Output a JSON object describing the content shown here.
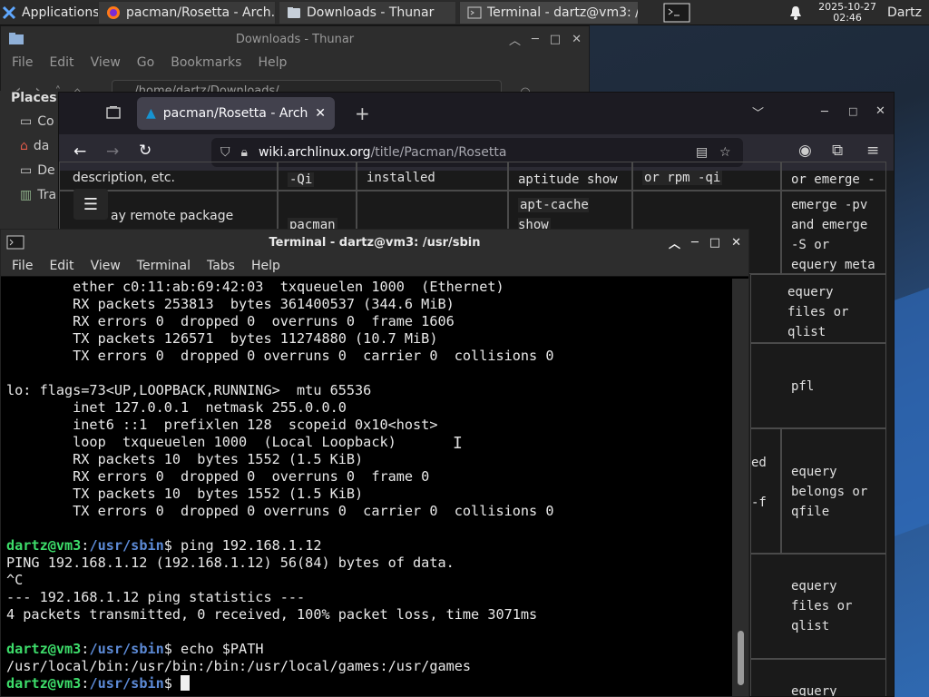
{
  "panel": {
    "apps_label": "Applications",
    "tasks": [
      {
        "label": "pacman/Rosetta - Arch...",
        "icon": "firefox-icon"
      },
      {
        "label": "Downloads - Thunar",
        "icon": "folder-icon"
      },
      {
        "label": "Terminal - dartz@vm3: /...",
        "icon": "terminal-icon"
      }
    ],
    "clock_date": "2025-10-27",
    "clock_time": "02:46",
    "user": "Dartz"
  },
  "thunar": {
    "title": "Downloads - Thunar",
    "menu": [
      "File",
      "Edit",
      "View",
      "Go",
      "Bookmarks",
      "Help"
    ],
    "path": "/home/dartz/Downloads/",
    "places_title": "Places",
    "places": [
      "Co",
      "da",
      "De",
      "Tra"
    ]
  },
  "firefox": {
    "tab_title": "pacman/Rosetta - ArchW",
    "url_host": "wiki.archlinux.org",
    "url_path": "/title/Pacman/Rosetta"
  },
  "wiki": {
    "row1_desc": "description, etc.",
    "row1_qi": "-Qi",
    "row1_installed": "installed",
    "row1_aptitude": "aptitude show",
    "row1_rpm": "or rpm -qi",
    "row1_emerge": "or emerge -S",
    "row2_desc": "ay remote package",
    "row2_pacman": "pacman",
    "row2_apt": "apt-cache show",
    "row2_emerge": "emerge -pv and emerge -S or equery meta",
    "row3": "equery files or qlist",
    "row4": "pfl",
    "row5_a": "ed",
    "row5_b": "-f",
    "row5": "equery belongs or qfile",
    "row6": "equery files or qlist",
    "row7": "equery"
  },
  "terminal": {
    "title": "Terminal - dartz@vm3: /usr/sbin",
    "menu": [
      "File",
      "Edit",
      "View",
      "Terminal",
      "Tabs",
      "Help"
    ],
    "prompt_user": "dartz@vm3",
    "prompt_path": "/usr/sbin",
    "lines": [
      "        ether c0:11:ab:69:42:03  txqueuelen 1000  (Ethernet)",
      "        RX packets 253813  bytes 361400537 (344.6 MiB)",
      "        RX errors 0  dropped 0  overruns 0  frame 1606",
      "        TX packets 126571  bytes 11274880 (10.7 MiB)",
      "        TX errors 0  dropped 0 overruns 0  carrier 0  collisions 0",
      "",
      "lo: flags=73<UP,LOOPBACK,RUNNING>  mtu 65536",
      "        inet 127.0.0.1  netmask 255.0.0.0",
      "        inet6 ::1  prefixlen 128  scopeid 0x10<host>",
      "        loop  txqueuelen 1000  (Local Loopback)",
      "        RX packets 10  bytes 1552 (1.5 KiB)",
      "        RX errors 0  dropped 0  overruns 0  frame 0",
      "        TX packets 10  bytes 1552 (1.5 KiB)",
      "        TX errors 0  dropped 0 overruns 0  carrier 0  collisions 0",
      ""
    ],
    "cmd1": " ping 192.168.1.12",
    "ping_out": [
      "PING 192.168.1.12 (192.168.1.12) 56(84) bytes of data.",
      "^C",
      "--- 192.168.1.12 ping statistics ---",
      "4 packets transmitted, 0 received, 100% packet loss, time 3071ms",
      ""
    ],
    "cmd2": " echo $PATH",
    "path_out": "/usr/local/bin:/usr/bin:/bin:/usr/local/games:/usr/games"
  }
}
